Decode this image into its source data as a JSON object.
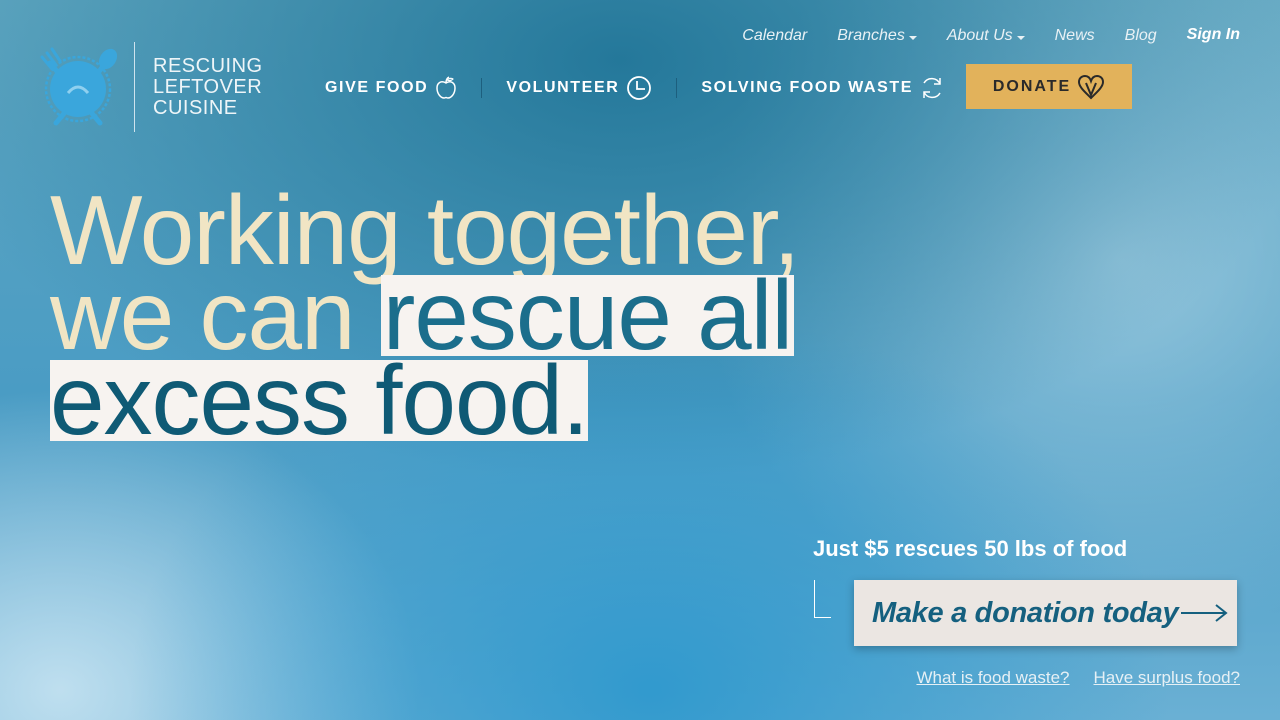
{
  "brand": {
    "lines": [
      "RESCUING",
      "LEFTOVER",
      "CUISINE"
    ],
    "icon": "fork-spoon-plate-icon",
    "color": "#3aa6dc"
  },
  "top_nav": {
    "calendar": "Calendar",
    "branches": "Branches",
    "about": "About Us",
    "news": "News",
    "blog": "Blog",
    "sign_in": "Sign In"
  },
  "main_nav": {
    "give_food": "GIVE FOOD",
    "give_food_icon": "apple-icon",
    "volunteer": "VOLUNTEER",
    "volunteer_icon": "clock-icon",
    "solving": "SOLVING FOOD WASTE",
    "solving_icon": "refresh-icon"
  },
  "donate": {
    "label": "DONATE",
    "icon": "heart-icon",
    "color": "#e2b25b"
  },
  "hero": {
    "line1": "Working together,",
    "line2_plain": "we can ",
    "line2_box": "rescue all",
    "line3_box": "excess food."
  },
  "promo": {
    "text": "Just $5 rescues 50 lbs of food",
    "cta": "Make a donation today",
    "cta_icon": "arrow-right-icon"
  },
  "footer_links": {
    "what_is": "What is food waste?",
    "surplus": "Have surplus food?"
  },
  "colors": {
    "accent_teal": "#1b6e8c",
    "cream": "#f1e5c4"
  }
}
